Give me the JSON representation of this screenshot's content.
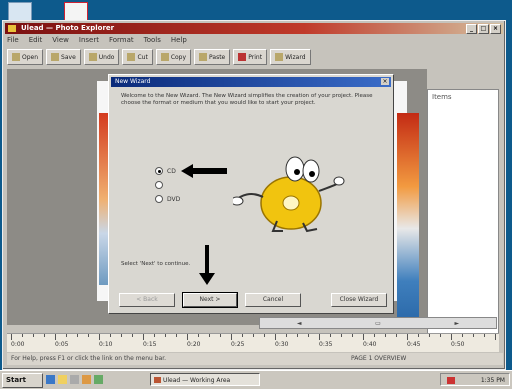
{
  "app": {
    "title": "Ulead — Photo Explorer",
    "menu": [
      "File",
      "Edit",
      "View",
      "Insert",
      "Format",
      "Tools",
      "Help"
    ],
    "toolbar": [
      {
        "label": "Open",
        "icon": "folder-icon"
      },
      {
        "label": "Save",
        "icon": "disk-icon"
      },
      {
        "label": "Undo",
        "icon": "undo-icon"
      },
      {
        "label": "Cut",
        "icon": "scissors-icon"
      },
      {
        "label": "Copy",
        "icon": "copy-icon"
      },
      {
        "label": "Paste",
        "icon": "paste-icon"
      },
      {
        "label": "Print",
        "icon": "printer-icon"
      },
      {
        "label": "Wizard",
        "icon": "wand-icon"
      }
    ],
    "panel_label": "Items",
    "ruler_labels": [
      "0:00",
      "0:05",
      "0:10",
      "0:15",
      "0:20",
      "0:25",
      "0:30",
      "0:35",
      "0:40",
      "0:45",
      "0:50"
    ],
    "status_left": "For Help, press F1 or click the link on the menu bar.",
    "status_right": "PAGE 1   OVERVIEW"
  },
  "dialog": {
    "title": "New Wizard",
    "intro": "Welcome to the New Wizard. The New Wizard simplifies the creation of your project. Please choose the format or medium that you would like to start your project.",
    "options": [
      {
        "label": "CD",
        "checked": true
      },
      {
        "label": "",
        "checked": false
      },
      {
        "label": "DVD",
        "checked": false
      }
    ],
    "hint": "Select 'Next' to continue.",
    "buttons": {
      "back": "< Back",
      "next": "Next >",
      "cancel": "Cancel",
      "close": "Close Wizard"
    }
  },
  "taskbar": {
    "start": "Start",
    "task": "Ulead — Working Area",
    "clock": "1:35 PM"
  }
}
